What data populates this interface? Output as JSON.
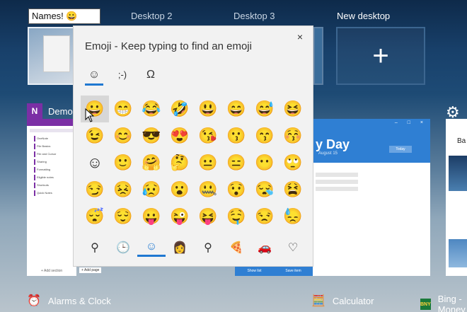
{
  "desktops": {
    "name_input_value": "Names! 😀",
    "items": [
      {
        "label": "Desktop 2"
      },
      {
        "label": "Desktop 3"
      },
      {
        "label": "New desktop"
      }
    ],
    "new_desktop_symbol": "+"
  },
  "tasks": {
    "onenote": {
      "badge": "N",
      "title": "Demo"
    },
    "onenote_sidebar": [
      "OneNote",
      "File Basics",
      "File and Cursor",
      "Sharing",
      "Formatting",
      "Eligible notes",
      "Shortcuts",
      "Quick Notes"
    ],
    "onenote_footer": [
      "+ Add section",
      "+ Add page"
    ],
    "calendar": {
      "title": "y Day",
      "date": "August 15",
      "button": "Today",
      "foot": [
        "Show list",
        "Save item"
      ]
    },
    "right_app": {
      "title": "Ba"
    }
  },
  "bottom": {
    "items": [
      {
        "label": "Alarms & Clock",
        "icon": "⏰"
      },
      {
        "label": "Calculator",
        "icon": "🧮"
      },
      {
        "label": "Bing - Money",
        "icon": "BNY"
      }
    ]
  },
  "emoji_panel": {
    "title": "Emoji - Keep typing to find an emoji",
    "close": "×",
    "tabs": [
      {
        "name": "emoji-tab",
        "glyph": "☺",
        "active": true
      },
      {
        "name": "kaomoji-tab",
        "glyph": ";-)",
        "active": false
      },
      {
        "name": "symbols-tab",
        "glyph": "Ω",
        "active": false
      }
    ],
    "emojis": [
      "😀",
      "😁",
      "😂",
      "🤣",
      "😃",
      "😄",
      "😅",
      "😆",
      "😉",
      "😊",
      "😎",
      "😍",
      "😘",
      "😗",
      "😙",
      "😚",
      "☺",
      "🙂",
      "🤗",
      "🤔",
      "😐",
      "😑",
      "😶",
      "🙄",
      "😏",
      "😣",
      "😥",
      "😮",
      "🤐",
      "😯",
      "😪",
      "😫",
      "😴",
      "😌",
      "😛",
      "😜",
      "😝",
      "🤤",
      "😒",
      "😓"
    ],
    "categories": [
      {
        "name": "search-icon",
        "glyph": "⚲"
      },
      {
        "name": "recent-icon",
        "glyph": "🕒"
      },
      {
        "name": "smiley-icon",
        "glyph": "☺",
        "active": true
      },
      {
        "name": "people-icon",
        "glyph": "👩"
      },
      {
        "name": "places-icon",
        "glyph": "⚲"
      },
      {
        "name": "food-icon",
        "glyph": "🍕"
      },
      {
        "name": "travel-icon",
        "glyph": "🚗"
      },
      {
        "name": "heart-icon",
        "glyph": "♡"
      }
    ]
  },
  "colors": {
    "accent": "#1f78d1",
    "onenote": "#7b2fa5",
    "calendar": "#2f7fd3"
  }
}
